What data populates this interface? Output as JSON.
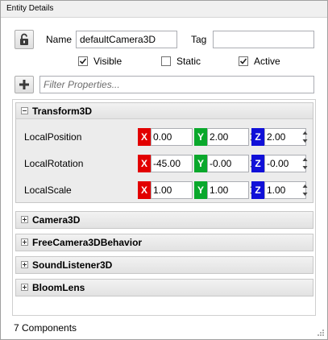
{
  "window": {
    "title": "Entity Details"
  },
  "entity": {
    "name_label": "Name",
    "name_value": "defaultCamera3D",
    "tag_label": "Tag",
    "tag_value": ""
  },
  "flags": [
    {
      "label": "Visible",
      "checked": true
    },
    {
      "label": "Static",
      "checked": false
    },
    {
      "label": "Active",
      "checked": true
    }
  ],
  "filter": {
    "placeholder": "Filter Properties..."
  },
  "components": [
    {
      "name": "Transform3D",
      "expanded": true,
      "properties": [
        {
          "label": "LocalPosition",
          "x": "0.00",
          "y": "2.00",
          "z": "2.00"
        },
        {
          "label": "LocalRotation",
          "x": "-45.00",
          "y": "-0.00",
          "z": "-0.00"
        },
        {
          "label": "LocalScale",
          "x": "1.00",
          "y": "1.00",
          "z": "1.00"
        }
      ]
    },
    {
      "name": "Camera3D",
      "expanded": false
    },
    {
      "name": "FreeCamera3DBehavior",
      "expanded": false
    },
    {
      "name": "SoundListener3D",
      "expanded": false
    },
    {
      "name": "BloomLens",
      "expanded": false
    }
  ],
  "axis_labels": {
    "x": "X",
    "y": "Y",
    "z": "Z"
  },
  "colors": {
    "x_axis": "#e20000",
    "y_axis": "#0aa82c",
    "z_axis": "#1010d8"
  },
  "footer": {
    "count_text": "7 Components"
  },
  "icons": {
    "lock": "unlock-icon",
    "add": "plus-icon",
    "expand": "expand-icon",
    "collapse": "collapse-icon"
  }
}
